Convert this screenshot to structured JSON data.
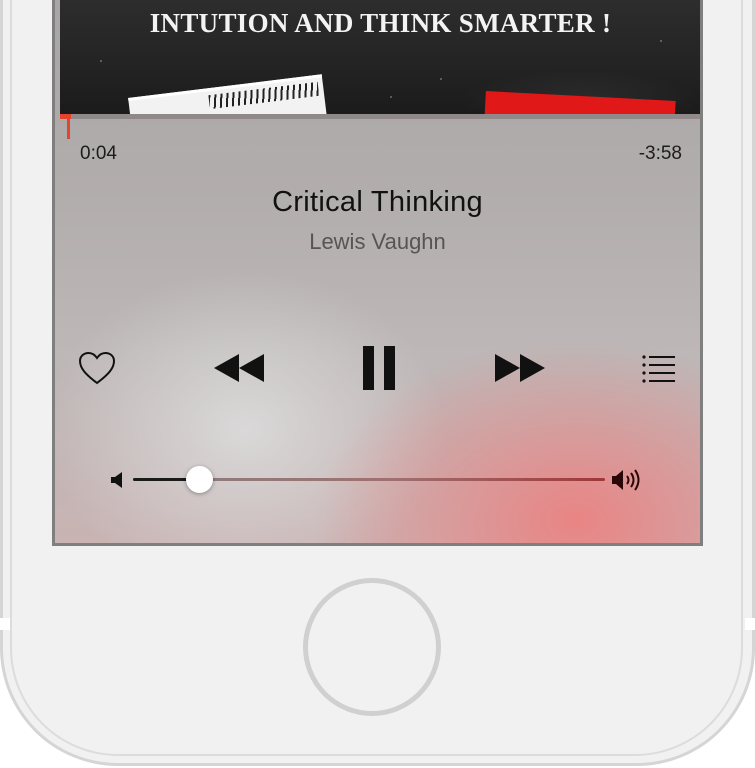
{
  "album_art": {
    "headline": "INTUTION AND THINK SMARTER !"
  },
  "playback": {
    "elapsed": "0:04",
    "remaining": "-3:58",
    "progress_fraction": 0.017
  },
  "track": {
    "title": "Critical Thinking",
    "artist": "Lewis Vaughn"
  },
  "controls": {
    "favorite_icon": "heart-outline-icon",
    "rewind_icon": "rewind-icon",
    "pause_icon": "pause-icon",
    "forward_icon": "fast-forward-icon",
    "queue_icon": "list-icon"
  },
  "volume": {
    "level_fraction": 0.14,
    "low_icon": "speaker-low-icon",
    "high_icon": "speaker-high-icon"
  },
  "colors": {
    "progress_accent": "#e4442f",
    "volume_high_tint": "#a03838"
  }
}
